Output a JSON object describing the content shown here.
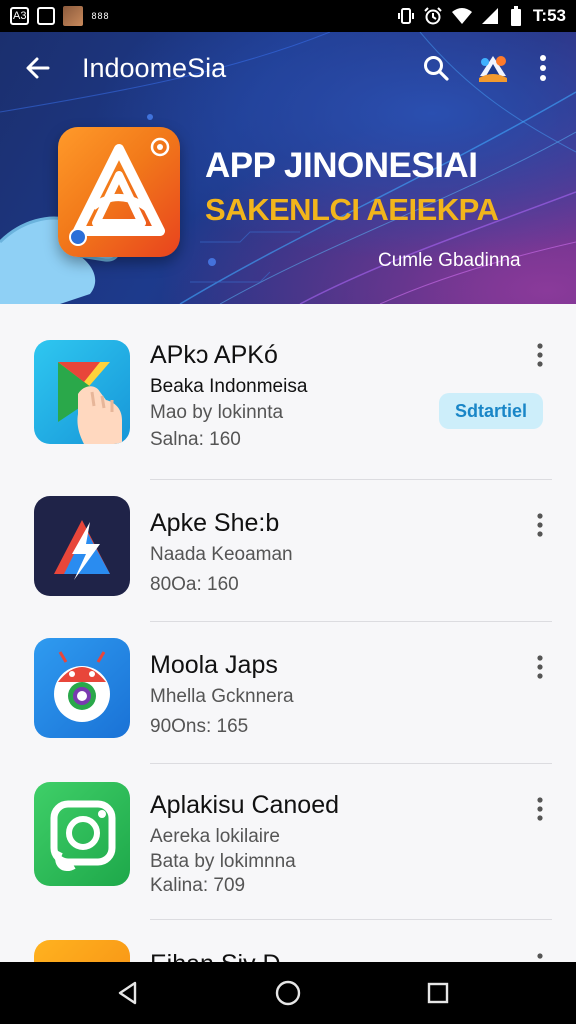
{
  "status_bar": {
    "left_icons": [
      {
        "name": "notification-badge-icon",
        "label": "A3"
      },
      {
        "name": "square-outline-icon",
        "label": ""
      },
      {
        "name": "photo-thumbnail-icon",
        "label": ""
      },
      {
        "name": "more-notifications-icon",
        "label": "888"
      }
    ],
    "right_icons": [
      "vibrate-icon",
      "alarm-icon",
      "wifi-icon",
      "signal-icon",
      "battery-icon"
    ],
    "time": "T:53"
  },
  "toolbar": {
    "title": "IndoomeSia",
    "icons": [
      "back-arrow-icon",
      "search-icon",
      "brand-badge-icon",
      "more-vert-icon"
    ]
  },
  "hero": {
    "title": "APP JINONESIAI",
    "subtitle": "SAKENLCI AEIEKPA",
    "caption": "Cumle Gbadinna",
    "colors": {
      "title": "#ffffff",
      "subtitle": "#f2b51c",
      "background": "#1d3a8c"
    }
  },
  "apps": [
    {
      "name": "APkɔ APKó",
      "line1": "Beaka Indonmeisa",
      "line2": "Mao by lokinnta",
      "stats": "Salna: 160",
      "action": "Sdtartiel",
      "icon": "play-store-hand-icon"
    },
    {
      "name": "Apke She:b",
      "line1": "Naada Keoaman",
      "line2": "",
      "stats": "80Oa: 160",
      "action": "",
      "icon": "lightning-triangle-icon"
    },
    {
      "name": "Moola Japs",
      "line1": "Mhella Gcknnera",
      "line2": "",
      "stats": "90Ons: 165",
      "action": "",
      "icon": "android-robot-icon"
    },
    {
      "name": "Aplakisu Canoed",
      "line1": "Aereka lokilaire",
      "line2": "Bata by lokimnna",
      "stats": "Kalina: 709",
      "action": "",
      "icon": "green-camera-icon"
    },
    {
      "name": "Eihan Siv D",
      "line1": "",
      "line2": "",
      "stats": "",
      "action": "",
      "icon": "orange-app-icon"
    }
  ],
  "nav_bar": {
    "buttons": [
      "back-triangle-icon",
      "home-circle-icon",
      "recents-square-icon"
    ]
  }
}
